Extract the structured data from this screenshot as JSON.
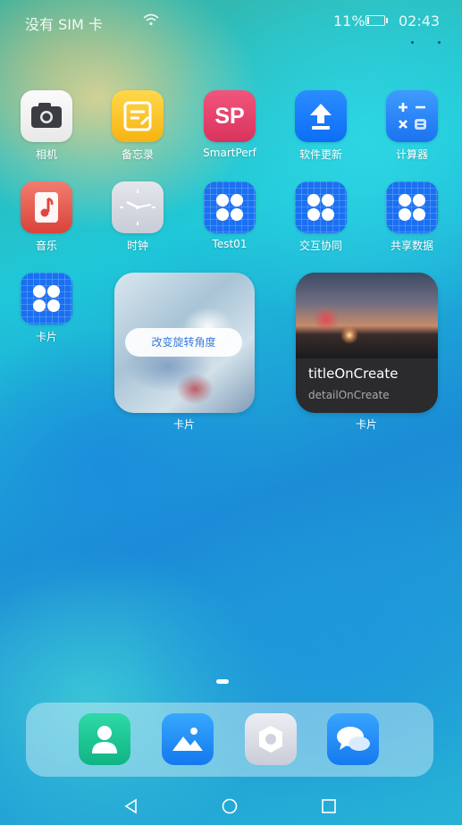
{
  "status_bar": {
    "carrier": "没有 SIM 卡",
    "battery_text": "11%",
    "battery_level": 0.11,
    "time": "02:43"
  },
  "apps": [
    {
      "label": "相机",
      "icon": "camera-icon"
    },
    {
      "label": "备忘录",
      "icon": "memo-icon"
    },
    {
      "label": "SmartPerf",
      "icon": "smartperf-icon",
      "icon_text": "SP"
    },
    {
      "label": "软件更新",
      "icon": "software-update-icon"
    },
    {
      "label": "计算器",
      "icon": "calculator-icon"
    },
    {
      "label": "音乐",
      "icon": "music-icon"
    },
    {
      "label": "时钟",
      "icon": "clock-icon"
    },
    {
      "label": "Test01",
      "icon": "app-grid-icon"
    },
    {
      "label": "交互协同",
      "icon": "app-grid-icon"
    },
    {
      "label": "共享数据",
      "icon": "app-grid-icon"
    },
    {
      "label": "卡片",
      "icon": "app-grid-icon"
    }
  ],
  "widgets": {
    "rotate_card": {
      "button_label": "改变旋转角度",
      "label": "卡片"
    },
    "photo_card": {
      "title": "titleOnCreate",
      "detail": "detailOnCreate",
      "label": "卡片"
    }
  },
  "dock": [
    {
      "icon": "contacts-icon"
    },
    {
      "icon": "gallery-icon"
    },
    {
      "icon": "settings-icon"
    },
    {
      "icon": "messages-icon"
    }
  ],
  "navbar": [
    "back-icon",
    "home-icon",
    "recents-icon"
  ],
  "colors": {
    "grid_app_blue": "#1a70f2",
    "button_text_blue": "#3a7cd8"
  }
}
